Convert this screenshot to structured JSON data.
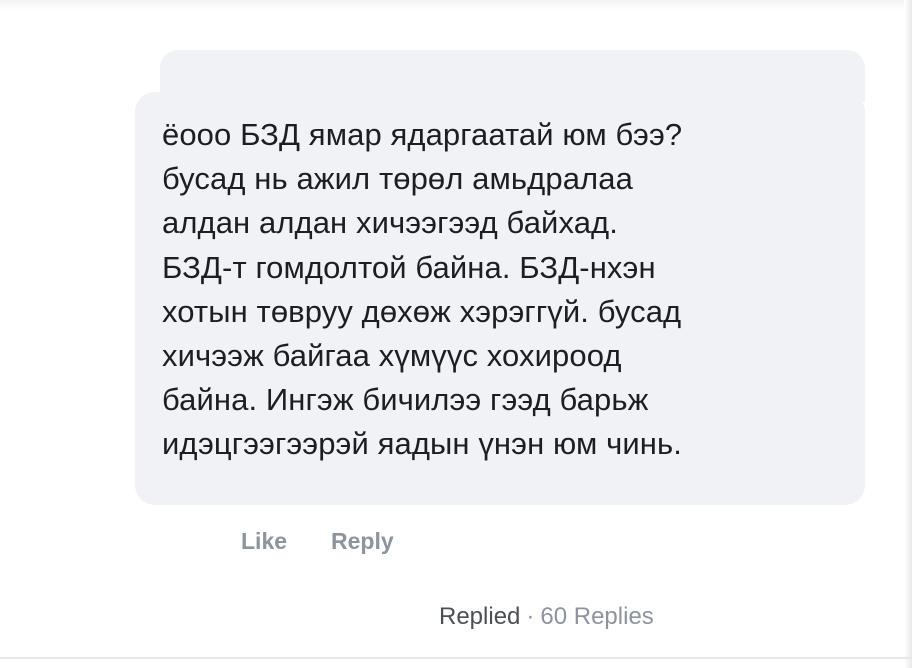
{
  "comment": {
    "lines": [
      "ёооо БЗД ямар ядаргаатай юм бээ?",
      "бусад нь ажил төрөл амьдралаа",
      "алдан алдан хичээгээд байхад.",
      "БЗД-т гомдолтой байна. БЗД-нхэн",
      "хотын төвруу дөхөж хэрэггүй. бусад",
      "хичээж байгаа хүмүүс хохироод",
      "байна. Ингэж бичилээ гээд барьж",
      "идэцгээгээрэй яадын үнэн юм чинь."
    ]
  },
  "actions": {
    "like_label": "Like",
    "reply_label": "Reply"
  },
  "replies": {
    "replied_label": "Replied",
    "separator": "·",
    "count_label": "60 Replies"
  },
  "colors": {
    "bubble_bg": "#f1f2f6",
    "text": "#1c1e21",
    "muted": "#8d949e"
  }
}
